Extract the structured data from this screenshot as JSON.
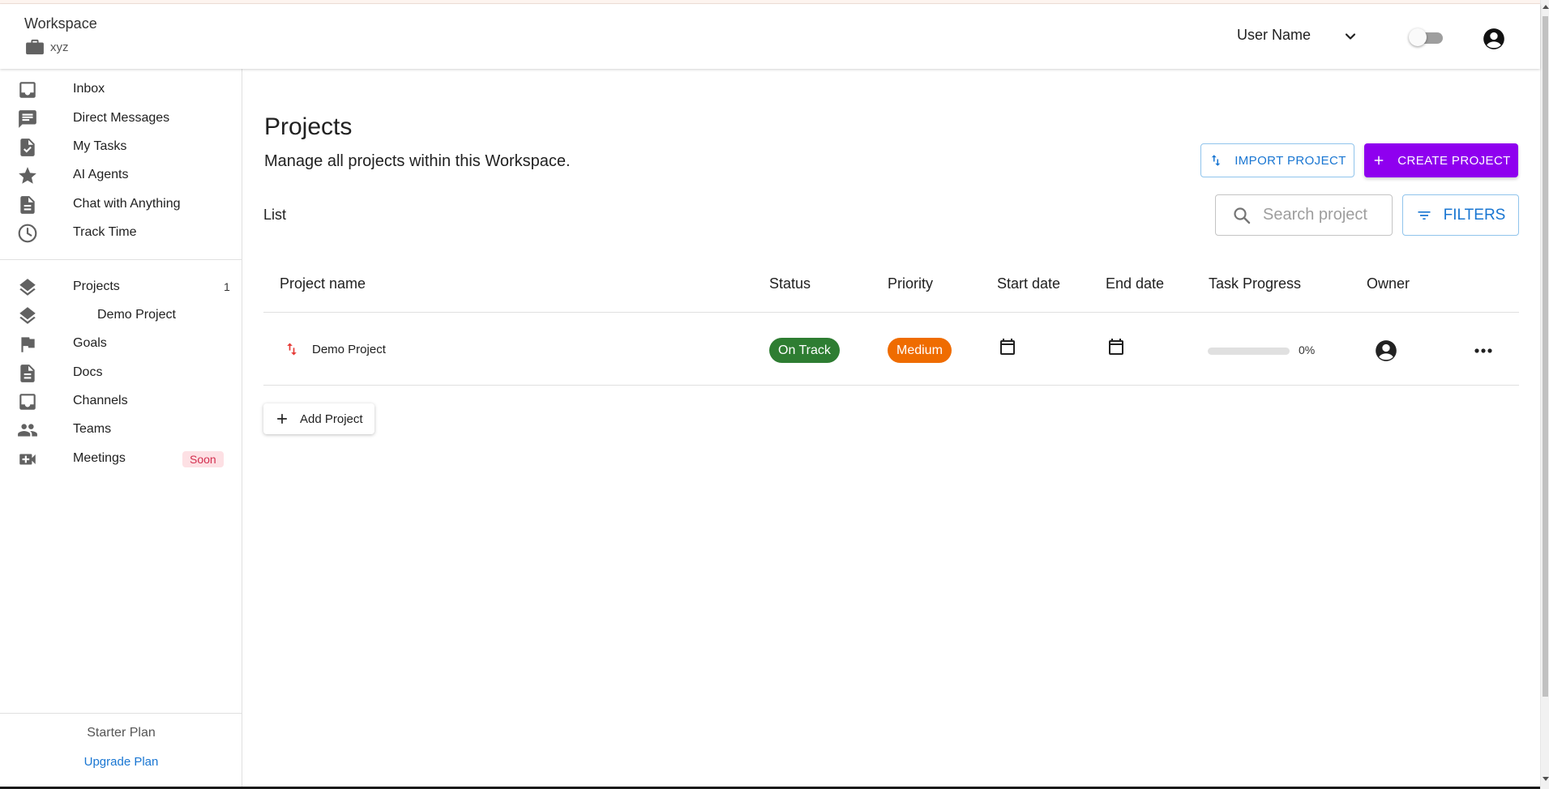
{
  "workspace": {
    "title": "Workspace",
    "name": "xyz"
  },
  "topbar": {
    "user_name": "User Name",
    "theme_toggle_on": false
  },
  "sidebar": {
    "items": [
      {
        "label": "Inbox",
        "icon": "inbox-icon"
      },
      {
        "label": "Direct Messages",
        "icon": "chat-icon"
      },
      {
        "label": "My Tasks",
        "icon": "task-icon"
      },
      {
        "label": "AI Agents",
        "icon": "star-icon"
      },
      {
        "label": "Chat with Anything",
        "icon": "document-icon"
      },
      {
        "label": "Track Time",
        "icon": "clock-icon"
      }
    ],
    "items2": [
      {
        "label": "Projects",
        "icon": "layers-icon",
        "count": "1"
      },
      {
        "label": "Demo Project",
        "icon": "layers-icon"
      },
      {
        "label": "Goals",
        "icon": "flag-icon"
      },
      {
        "label": "Docs",
        "icon": "document-icon"
      },
      {
        "label": "Channels",
        "icon": "inbox-icon"
      },
      {
        "label": "Teams",
        "icon": "people-icon"
      },
      {
        "label": "Meetings",
        "icon": "video-icon",
        "badge": "Soon"
      }
    ],
    "plan": "Starter Plan",
    "upgrade": "Upgrade Plan"
  },
  "main": {
    "title": "Projects",
    "subtitle": "Manage all projects within this Workspace.",
    "import_label": "IMPORT PROJECT",
    "create_label": "CREATE PROJECT",
    "view_label": "List",
    "search_placeholder": "Search project",
    "filters_label": "FILTERS",
    "columns": [
      "Project name",
      "Status",
      "Priority",
      "Start date",
      "End date",
      "Task Progress",
      "Owner"
    ],
    "rows": [
      {
        "name": "Demo Project",
        "status": "On Track",
        "priority": "Medium",
        "progress_pct": 0,
        "progress_label": "0%"
      }
    ],
    "add_label": "Add Project"
  },
  "colors": {
    "accent": "#8f00ef",
    "link": "#1976d2",
    "status_on_track": "#2e7d32",
    "priority_medium": "#ef6c00",
    "soon_bg": "#fde0e4",
    "soon_fg": "#d32f4f"
  }
}
